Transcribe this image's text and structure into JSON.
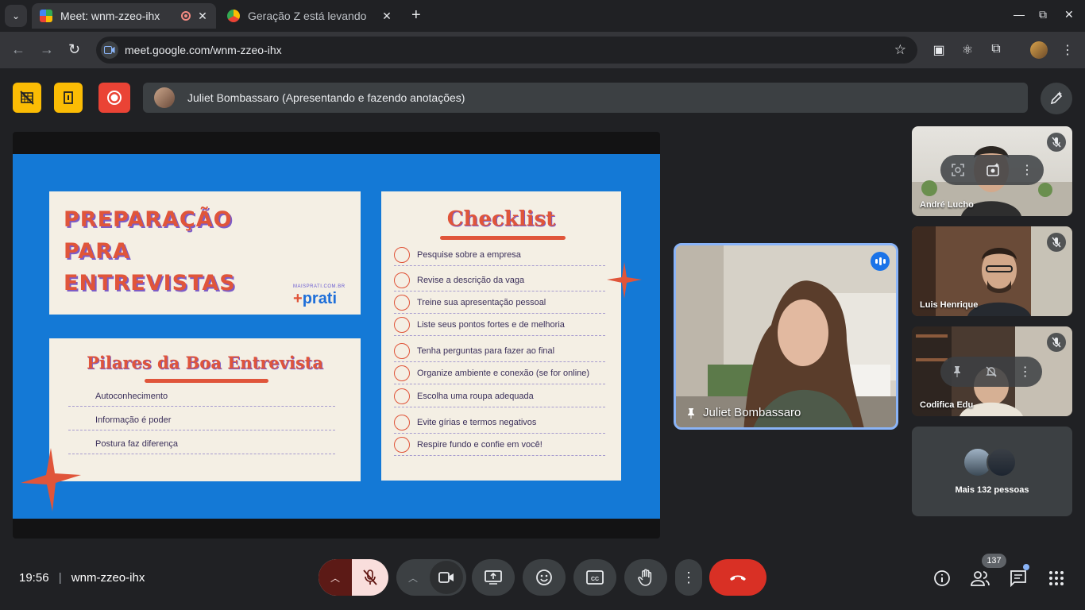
{
  "browser": {
    "tabs": [
      {
        "title": "Meet: wnm-zzeo-ihx",
        "active": true
      },
      {
        "title": "Geração Z está levando",
        "active": false
      }
    ],
    "url": "meet.google.com/wnm-zzeo-ihx"
  },
  "meet": {
    "presenter_bar": "Juliet Bombassaro (Apresentando e fazendo anotações)",
    "slide": {
      "main_title": [
        "PREPARAÇÃO",
        "PARA",
        "ENTREVISTAS"
      ],
      "brand_small": "MAISPRATI.COM.BR",
      "brand_prefix": "+",
      "brand_name": "prati",
      "checklist_title": "Checklist",
      "checklist": [
        "Pesquise sobre a empresa",
        "Revise a descrição da vaga",
        "Treine sua apresentação pessoal",
        "Liste seus pontos fortes e de melhoria",
        "Tenha perguntas para fazer ao final",
        "Organize ambiente e conexão (se for online)",
        "Escolha uma roupa adequada",
        "Evite gírias e termos negativos",
        "Respire fundo e confie em você!"
      ],
      "pillars_title": "Pilares da Boa Entrevista",
      "pillars": [
        "Autoconhecimento",
        "Informação é poder",
        "Postura faz diferença"
      ]
    },
    "pinned": {
      "name": "Juliet Bombassaro"
    },
    "participants": [
      {
        "name": "André Lucho"
      },
      {
        "name": "Luis Henrique"
      },
      {
        "name": "Codifica Edu"
      }
    ],
    "more_people": "Mais 132 pessoas",
    "time": "19:56",
    "meeting_code": "wnm-zzeo-ihx",
    "participant_count": "137",
    "colors": {
      "accent": "#8ab4f8",
      "end_call": "#d93025",
      "mic_off": "#f9dedc",
      "yellow": "#fbbc04"
    }
  }
}
